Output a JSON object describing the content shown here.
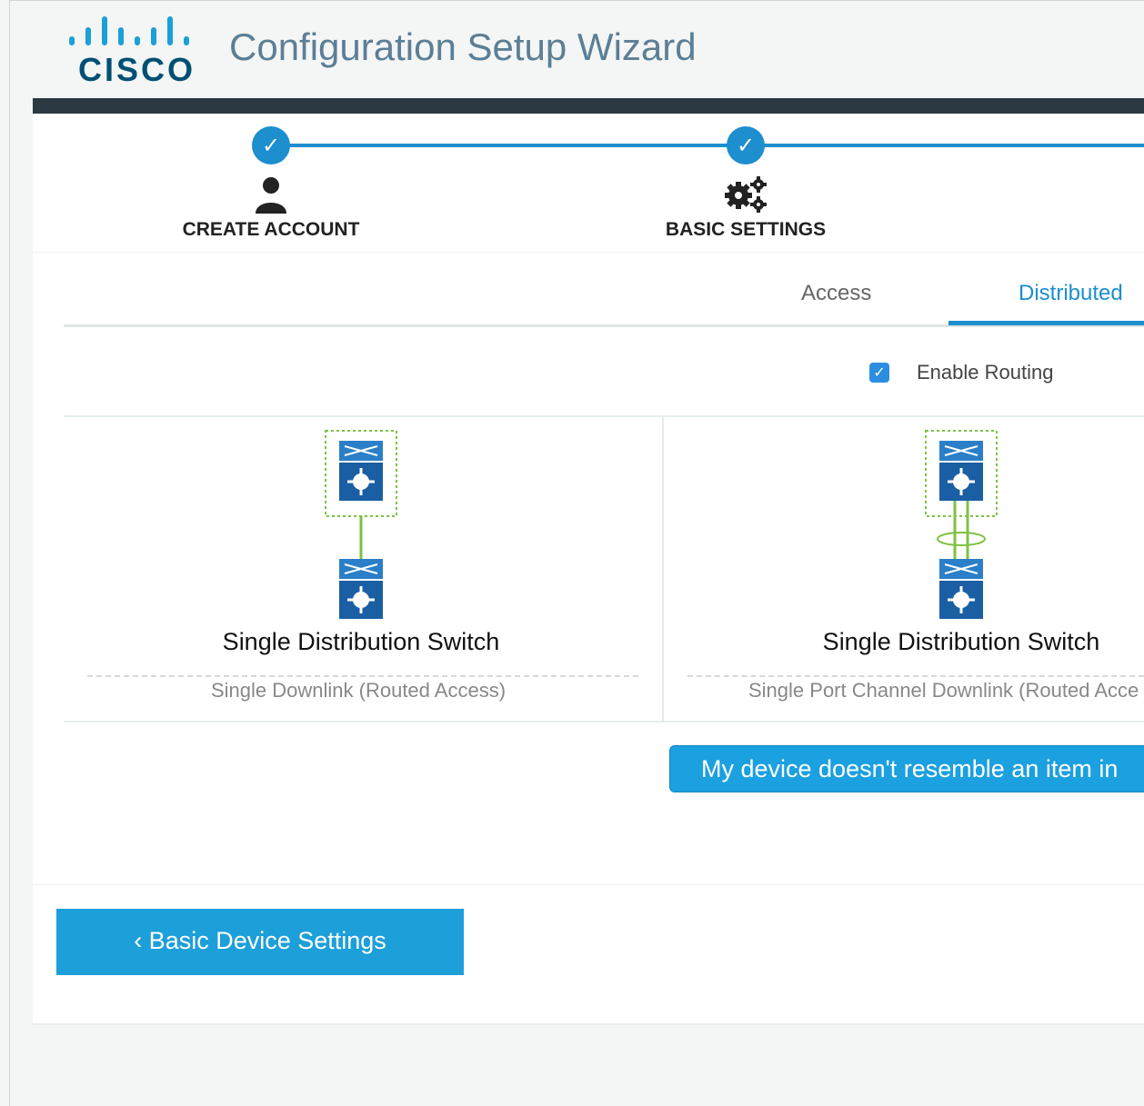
{
  "header": {
    "logo_text": "CISCO",
    "title": "Configuration Setup Wizard"
  },
  "colors": {
    "accent": "#1d8ece",
    "dark_bar": "#2b3a42",
    "title": "#5b7f95"
  },
  "stepper": {
    "steps": [
      {
        "label": "CREATE ACCOUNT",
        "status": "complete",
        "icon": "user-icon"
      },
      {
        "label": "BASIC SETTINGS",
        "status": "complete",
        "icon": "gears-icon"
      }
    ],
    "check_glyph": "✓"
  },
  "tabs": {
    "items": [
      {
        "label": "Access",
        "active": false
      },
      {
        "label": "Distributed",
        "active": true
      }
    ]
  },
  "routing": {
    "checked": true,
    "check_glyph": "✓",
    "label": "Enable Routing"
  },
  "cards": [
    {
      "title": "Single Distribution Switch",
      "subtitle": "Single Downlink (Routed Access)",
      "diagram": "single-downlink-diagram"
    },
    {
      "title": "Single Distribution Switch",
      "subtitle": "Single Port Channel Downlink (Routed Acce",
      "diagram": "port-channel-downlink-diagram"
    }
  ],
  "buttons": {
    "resemble": "My device doesn't resemble an item in",
    "back": "‹ Basic Device Settings"
  }
}
